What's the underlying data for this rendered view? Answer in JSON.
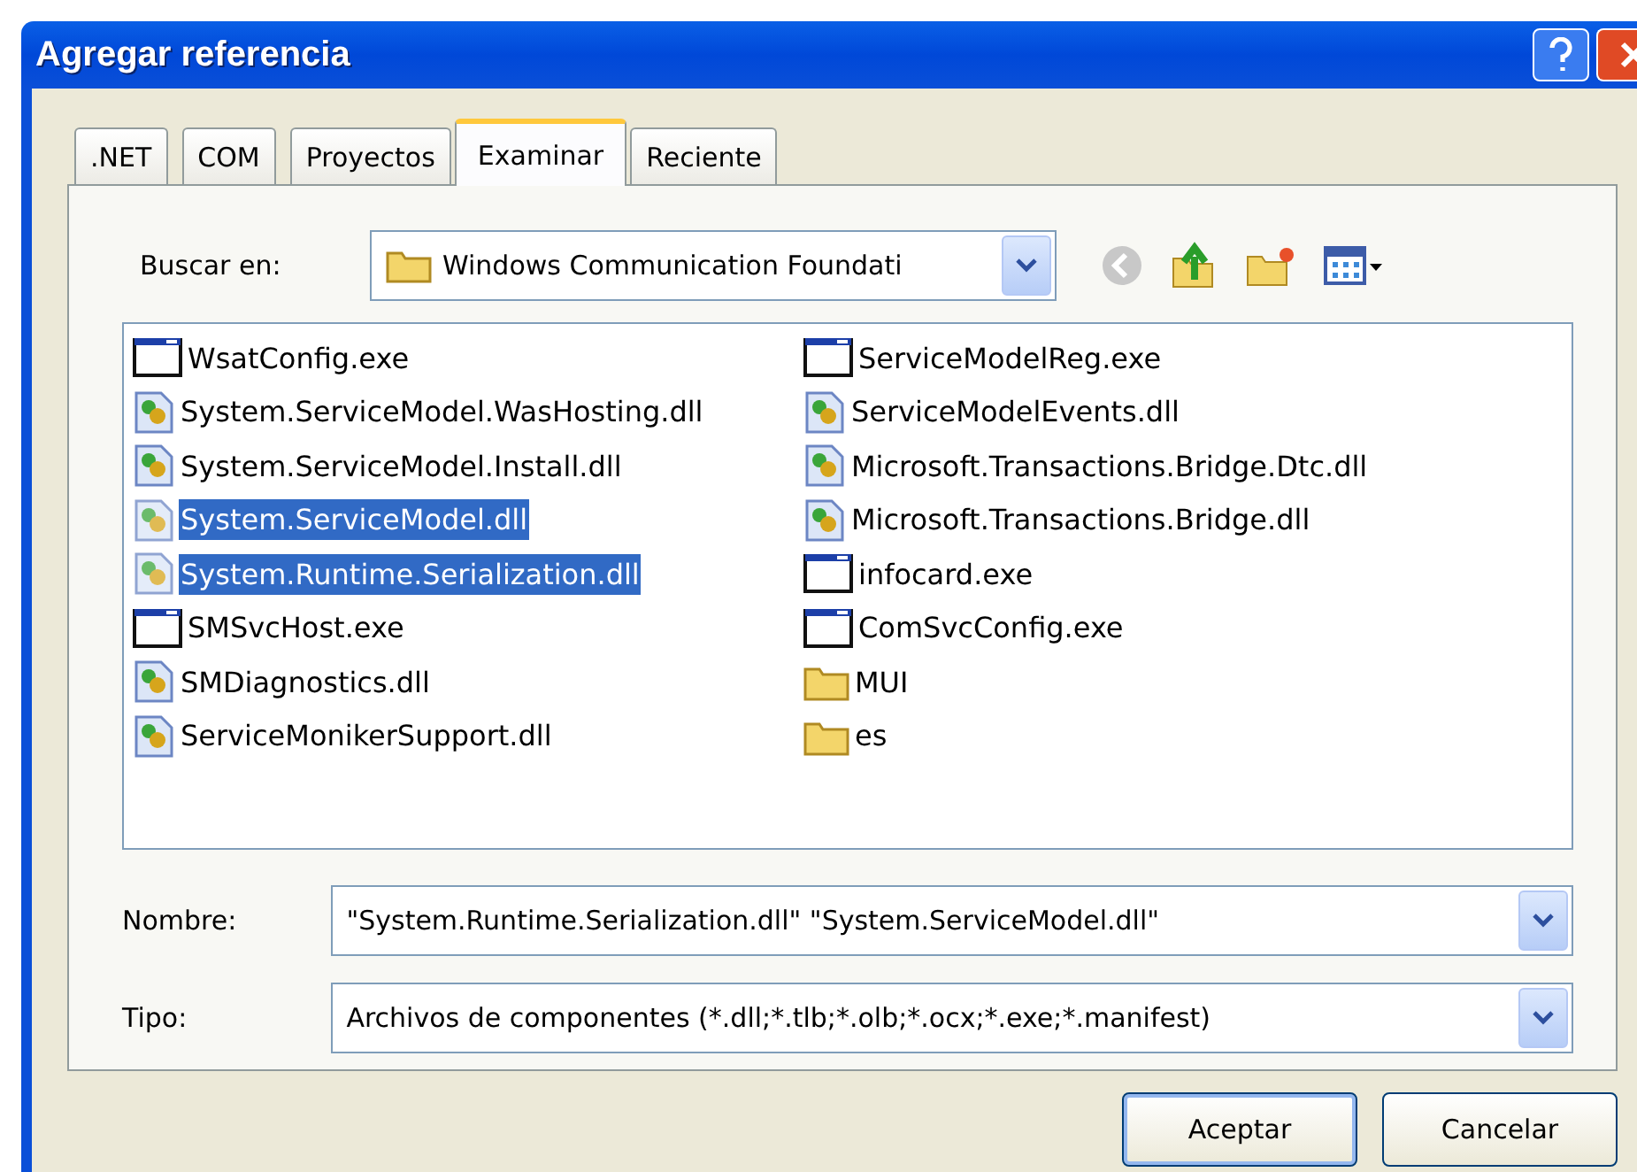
{
  "window": {
    "title": "Agregar referencia"
  },
  "tabs": [
    {
      "label": ".NET",
      "selected": false
    },
    {
      "label": "COM",
      "selected": false
    },
    {
      "label": "Proyectos",
      "selected": false
    },
    {
      "label": "Examinar",
      "selected": true
    },
    {
      "label": "Reciente",
      "selected": false
    }
  ],
  "look_in": {
    "label": "Buscar en:",
    "value": "Windows Communication Foundati"
  },
  "files": [
    {
      "name": "WsatConfig.exe",
      "kind": "exe",
      "selected": false
    },
    {
      "name": "System.ServiceModel.WasHosting.dll",
      "kind": "dll",
      "selected": false
    },
    {
      "name": "System.ServiceModel.Install.dll",
      "kind": "dll",
      "selected": false
    },
    {
      "name": "System.ServiceModel.dll",
      "kind": "dll",
      "selected": true
    },
    {
      "name": "System.Runtime.Serialization.dll",
      "kind": "dll",
      "selected": true
    },
    {
      "name": "SMSvcHost.exe",
      "kind": "exe",
      "selected": false
    },
    {
      "name": "SMDiagnostics.dll",
      "kind": "dll",
      "selected": false
    },
    {
      "name": "ServiceMonikerSupport.dll",
      "kind": "dll",
      "selected": false
    },
    {
      "name": "ServiceModelReg.exe",
      "kind": "exe",
      "selected": false
    },
    {
      "name": "ServiceModelEvents.dll",
      "kind": "dll",
      "selected": false
    },
    {
      "name": "Microsoft.Transactions.Bridge.Dtc.dll",
      "kind": "dll",
      "selected": false
    },
    {
      "name": "Microsoft.Transactions.Bridge.dll",
      "kind": "dll",
      "selected": false
    },
    {
      "name": "infocard.exe",
      "kind": "exe",
      "selected": false
    },
    {
      "name": "ComSvcConfig.exe",
      "kind": "exe",
      "selected": false
    },
    {
      "name": "MUI",
      "kind": "folder",
      "selected": false
    },
    {
      "name": "es",
      "kind": "folder",
      "selected": false
    }
  ],
  "name_field": {
    "label": "Nombre:",
    "value": "\"System.Runtime.Serialization.dll\" \"System.ServiceModel.dll\""
  },
  "type_field": {
    "label": "Tipo:",
    "value": "Archivos de componentes (*.dll;*.tlb;*.olb;*.ocx;*.exe;*.manifest)"
  },
  "buttons": [
    {
      "label": "Aceptar",
      "default": true
    },
    {
      "label": "Cancelar",
      "default": false
    }
  ]
}
